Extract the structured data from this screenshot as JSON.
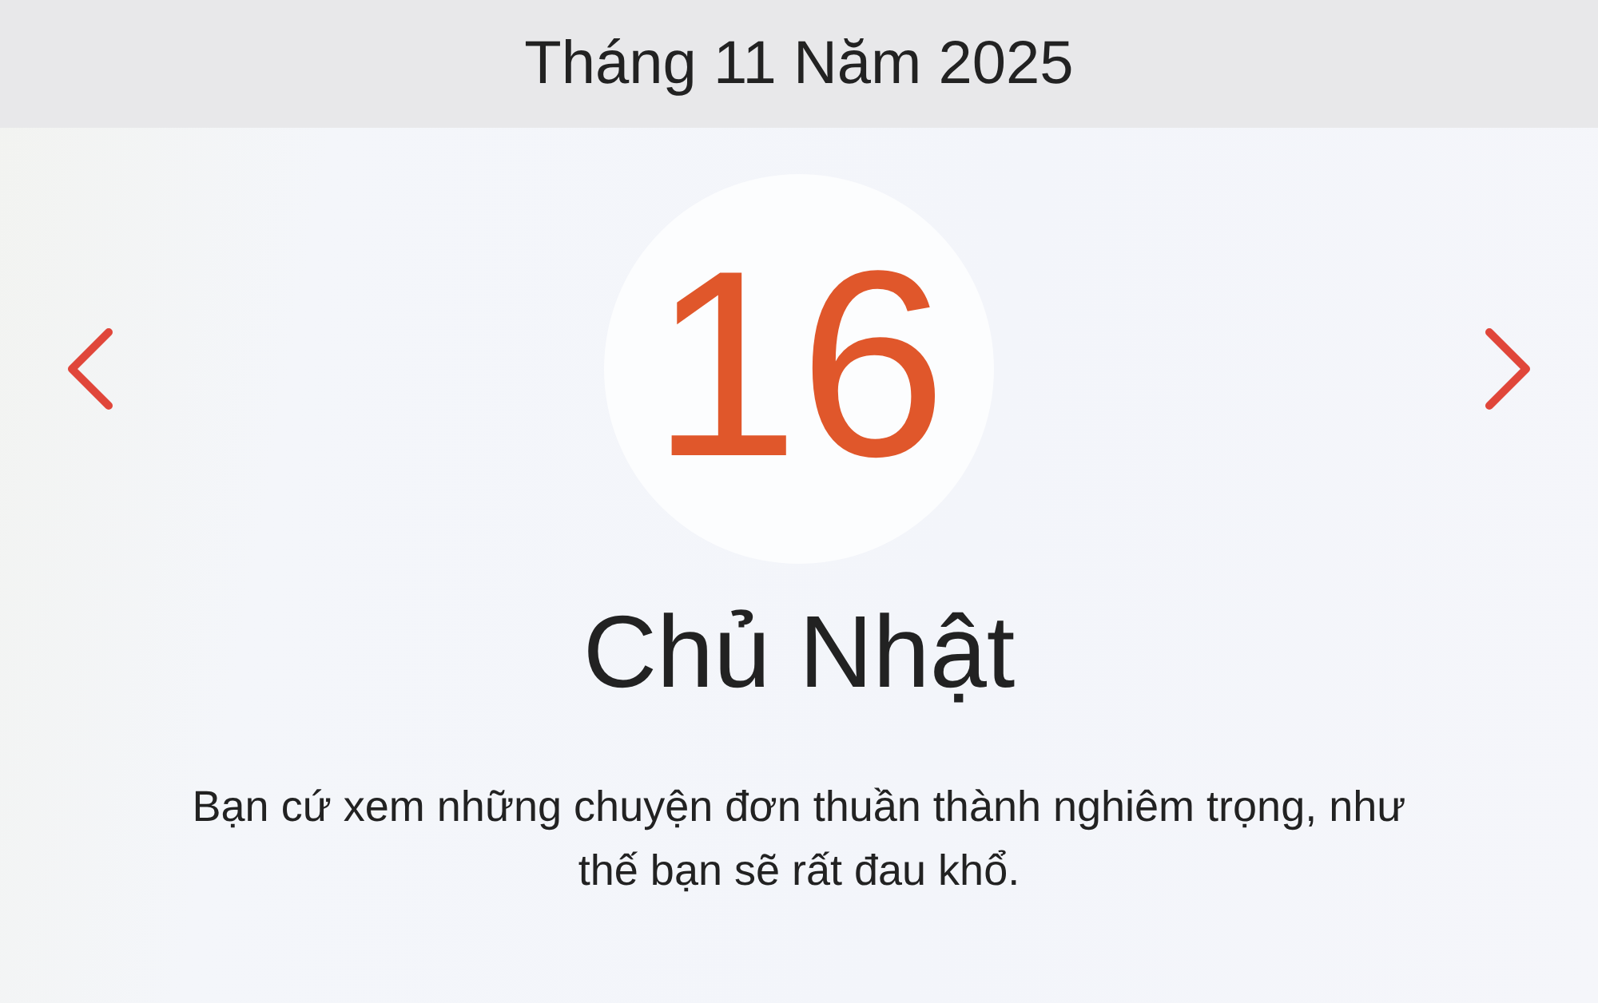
{
  "header": {
    "title": "Tháng 11 Năm 2025"
  },
  "day": {
    "number": "16",
    "weekday": "Chủ Nhật"
  },
  "quote": "Bạn cứ xem những chuyện đơn thuần thành nghiêm trọng, như thế bạn sẽ rất đau khổ."
}
